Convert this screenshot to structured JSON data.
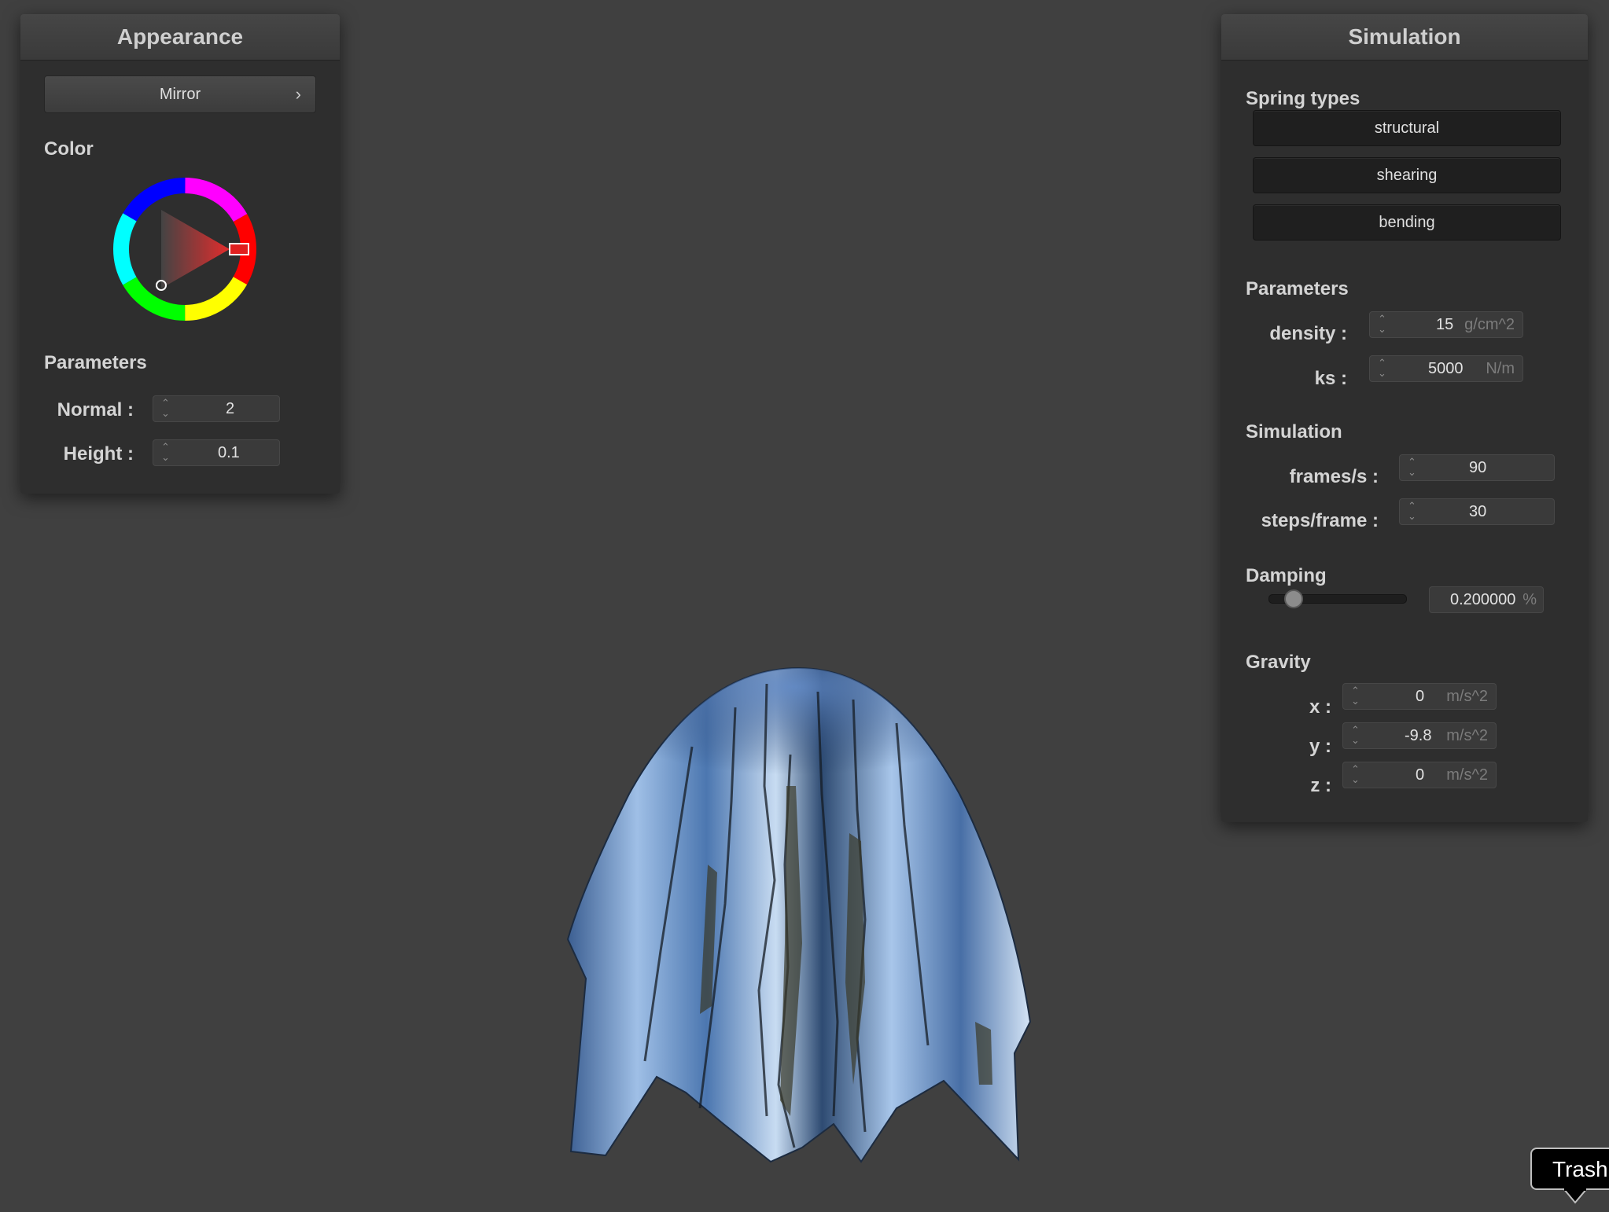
{
  "appearance": {
    "title": "Appearance",
    "shader_label": "Mirror",
    "color_label": "Color",
    "parameters_label": "Parameters",
    "normal": {
      "label": "Normal :",
      "value": "2"
    },
    "height": {
      "label": "Height :",
      "value": "0.1"
    }
  },
  "simulation": {
    "title": "Simulation",
    "spring_types_label": "Spring types",
    "spring_buttons": [
      "structural",
      "shearing",
      "bending"
    ],
    "parameters_label": "Parameters",
    "density": {
      "label": "density :",
      "value": "15",
      "unit": "g/cm^2"
    },
    "ks": {
      "label": "ks :",
      "value": "5000",
      "unit": "N/m"
    },
    "sim_label": "Simulation",
    "fps": {
      "label": "frames/s :",
      "value": "90"
    },
    "steps": {
      "label": "steps/frame :",
      "value": "30"
    },
    "damping_label": "Damping",
    "damping": {
      "value": "0.200000",
      "unit": "%"
    },
    "gravity_label": "Gravity",
    "gx": {
      "label": "x :",
      "value": "0",
      "unit": "m/s^2"
    },
    "gy": {
      "label": "y :",
      "value": "-9.8",
      "unit": "m/s^2"
    },
    "gz": {
      "label": "z :",
      "value": "0",
      "unit": "m/s^2"
    }
  },
  "tooltip": {
    "text": "Trash"
  },
  "colors": {
    "panel": "#2e2e2e",
    "background": "#404040",
    "selected_color": "#e02020"
  }
}
